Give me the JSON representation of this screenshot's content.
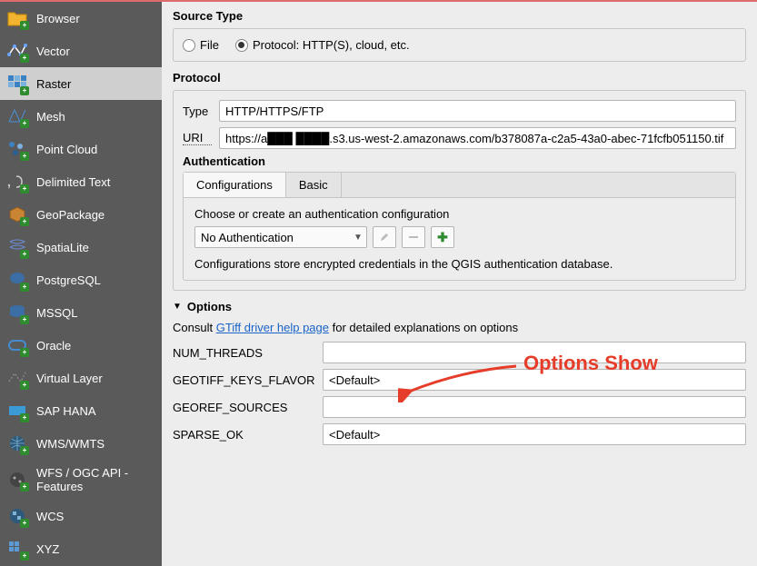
{
  "sidebar": {
    "items": [
      {
        "label": "Browser",
        "icon": "folder-icon"
      },
      {
        "label": "Vector",
        "icon": "vector-icon"
      },
      {
        "label": "Raster",
        "icon": "raster-icon"
      },
      {
        "label": "Mesh",
        "icon": "mesh-icon"
      },
      {
        "label": "Point Cloud",
        "icon": "pointcloud-icon"
      },
      {
        "label": "Delimited Text",
        "icon": "delimited-icon"
      },
      {
        "label": "GeoPackage",
        "icon": "geopackage-icon"
      },
      {
        "label": "SpatiaLite",
        "icon": "spatialite-icon"
      },
      {
        "label": "PostgreSQL",
        "icon": "postgresql-icon"
      },
      {
        "label": "MSSQL",
        "icon": "mssql-icon"
      },
      {
        "label": "Oracle",
        "icon": "oracle-icon"
      },
      {
        "label": "Virtual Layer",
        "icon": "virtuallayer-icon"
      },
      {
        "label": "SAP HANA",
        "icon": "saphana-icon"
      },
      {
        "label": "WMS/WMTS",
        "icon": "wms-icon"
      },
      {
        "label": "WFS / OGC API - Features",
        "icon": "wfs-icon"
      },
      {
        "label": "WCS",
        "icon": "wcs-icon"
      },
      {
        "label": "XYZ",
        "icon": "xyz-icon"
      }
    ],
    "selected_index": 2
  },
  "source_type": {
    "title": "Source Type",
    "file_label": "File",
    "protocol_label": "Protocol: HTTP(S), cloud, etc.",
    "selected": "protocol"
  },
  "protocol": {
    "title": "Protocol",
    "type_label": "Type",
    "type_value": "HTTP/HTTPS/FTP",
    "uri_label": "URI",
    "uri_value": "https://a███ ████.s3.us-west-2.amazonaws.com/b378087a-c2a5-43a0-abec-71fcfb051150.tif",
    "auth": {
      "title": "Authentication",
      "tab_config": "Configurations",
      "tab_basic": "Basic",
      "choose_text": "Choose or create an authentication configuration",
      "select_value": "No Authentication",
      "help_text": "Configurations store encrypted credentials in the QGIS authentication database."
    }
  },
  "options": {
    "title": "Options",
    "help_prefix": "Consult ",
    "help_link": "GTiff driver help page",
    "help_suffix": " for detailed explanations on options",
    "rows": [
      {
        "label": "NUM_THREADS",
        "value": ""
      },
      {
        "label": "GEOTIFF_KEYS_FLAVOR",
        "value": "<Default>"
      },
      {
        "label": "GEOREF_SOURCES",
        "value": ""
      },
      {
        "label": "SPARSE_OK",
        "value": "<Default>"
      }
    ]
  },
  "annotation": {
    "text": "Options Show"
  }
}
